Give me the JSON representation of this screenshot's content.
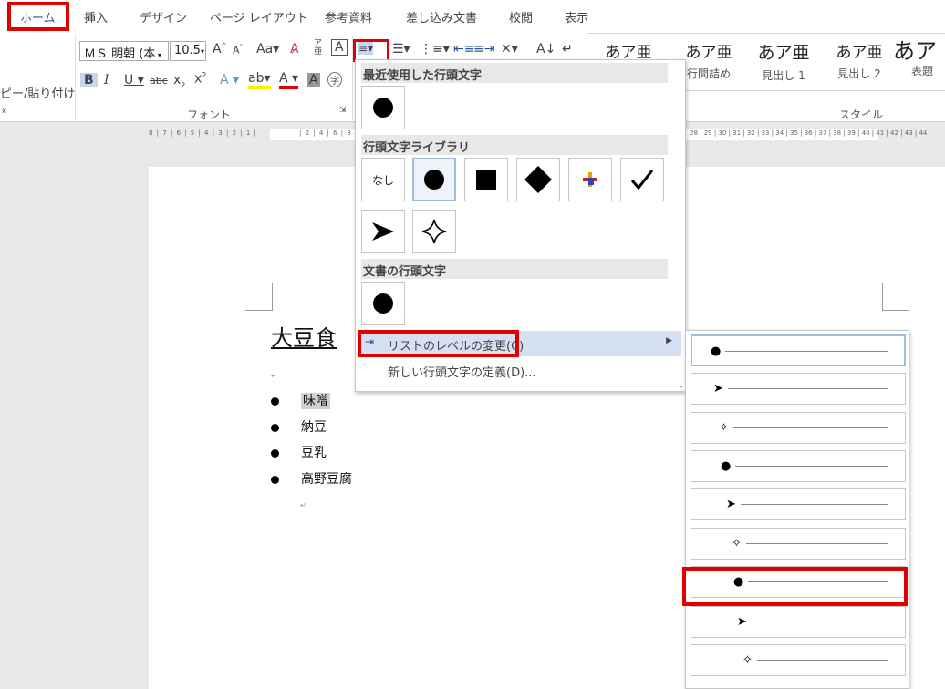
{
  "tabs": [
    "ホーム",
    "挿入",
    "デザイン",
    "ページ レイアウト",
    "参考資料",
    "差し込み文書",
    "校閲",
    "表示"
  ],
  "ribbon": {
    "font_name": "ＭＳ 明朝 (本",
    "font_size": "10.5",
    "paste_label": "ピー/貼り付け",
    "font_group_label": "フォント",
    "styles_group_label": "スタイル",
    "styles": [
      {
        "preview": "あア亜",
        "name": ""
      },
      {
        "preview": "あア亜",
        "name": "行間詰め"
      },
      {
        "preview": "あア亜",
        "name": "見出し 1"
      },
      {
        "preview": "あア亜",
        "name": "見出し 2"
      },
      {
        "preview": "あア",
        "name": "表題"
      }
    ]
  },
  "ruler": {
    "left_numbers": "8 | 7 | 6 | 5 | 4 | 3 | 2 | 1 |",
    "right_numbers": "| 2 | 4 | 6 | 8 |",
    "far_numbers": "28 | 29 | 30 | 31 | 32 | 33 | 34 | 35 | 36 | 37 | 38 | 39 | 40 | 41 | 42 | 43 | 44"
  },
  "document": {
    "title": "大豆食",
    "items": [
      "味噌",
      "納豆",
      "豆乳",
      "高野豆腐"
    ]
  },
  "bullet_dropdown": {
    "recent_header": "最近使用した行頭文字",
    "library_header": "行頭文字ライブラリ",
    "doc_header": "文書の行頭文字",
    "none_label": "なし",
    "change_level": "リストのレベルの変更(C)",
    "define_new": "新しい行頭文字の定義(D)..."
  },
  "levels": [
    {
      "symbol": "●"
    },
    {
      "symbol": "➤"
    },
    {
      "symbol": "✧"
    },
    {
      "symbol": "●"
    },
    {
      "symbol": "➤"
    },
    {
      "symbol": "✧"
    },
    {
      "symbol": "●"
    },
    {
      "symbol": "➤"
    },
    {
      "symbol": "✧"
    }
  ],
  "colors": {
    "highlight_box": "#e00000",
    "accent": "#2b579a",
    "hover": "#d5e1f2"
  }
}
